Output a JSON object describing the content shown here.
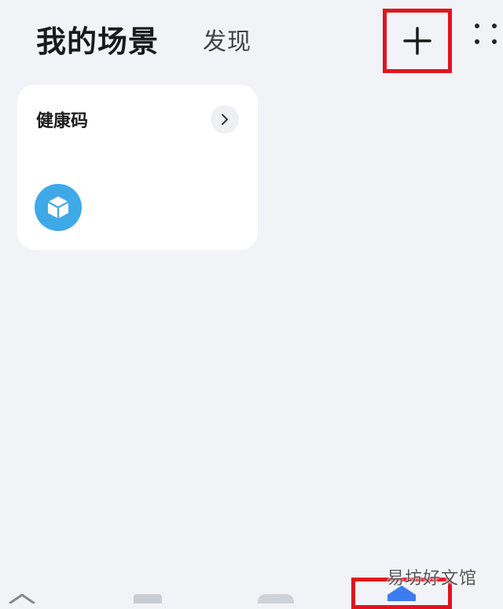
{
  "header": {
    "title": "我的场景",
    "tab_discover": "发现",
    "add_icon": "plus-icon",
    "more_icon": "more-dots-icon"
  },
  "scenes": [
    {
      "title": "健康码",
      "icon": "cube-icon",
      "icon_color": "#3fa9e8"
    }
  ],
  "colors": {
    "background": "#f2f3f7",
    "card": "#ffffff",
    "highlight": "#e0141f",
    "accent": "#3d7cf0"
  },
  "watermark": "易坊好文馆"
}
